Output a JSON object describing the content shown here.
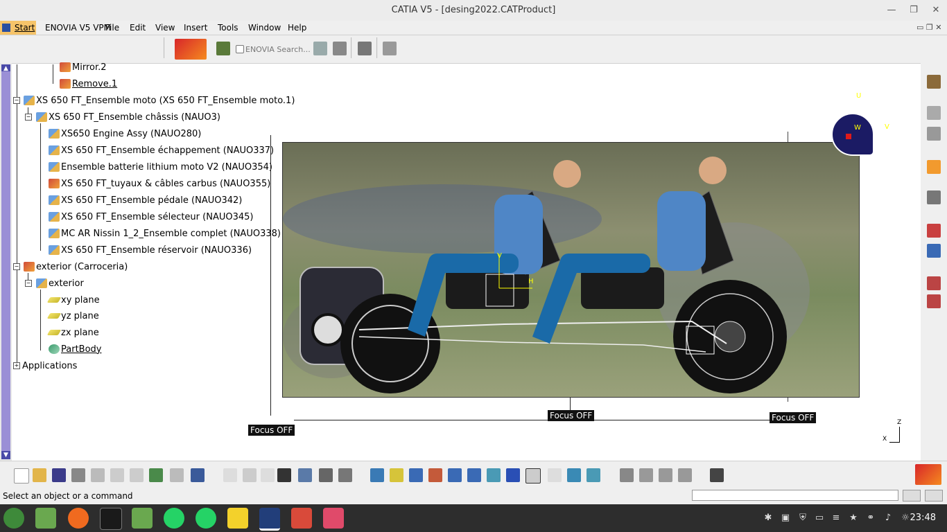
{
  "window": {
    "title": "CATIA V5 - [desing2022.CATProduct]"
  },
  "menubar": {
    "start": "Start",
    "items": [
      "ENOVIA V5 VPM",
      "File",
      "Edit",
      "View",
      "Insert",
      "Tools",
      "Window",
      "Help"
    ]
  },
  "toolbar": {
    "enovia_search": "ENOVIA Search..."
  },
  "tree": {
    "mirror": "Mirror.2",
    "remove": "Remove.1",
    "root": "XS 650 FT_Ensemble moto (XS 650 FT_Ensemble moto.1)",
    "chassis": "XS 650 FT_Ensemble châssis (NAUO3)",
    "children": [
      "XS650 Engine Assy (NAUO280)",
      "XS 650 FT_Ensemble échappement (NAUO337)",
      "Ensemble batterie lithium moto V2 (NAUO354)",
      "XS 650 FT_tuyaux & câbles carbus (NAUO355)",
      "XS 650 FT_Ensemble pédale (NAUO342)",
      "XS 650 FT_Ensemble sélecteur (NAUO345)",
      "MC AR Nissin 1_2_Ensemble complet (NAUO338)",
      "XS 650 FT_Ensemble réservoir (NAUO336)"
    ],
    "exterior_root": "exterior (Carroceria)",
    "exterior": "exterior",
    "xy_plane": "xy plane",
    "yz_plane": "yz plane",
    "zx_plane": "zx plane",
    "partbody": "PartBody",
    "applications": "Applications"
  },
  "viewport": {
    "focus_left": "Focus OFF",
    "focus_center": "Focus OFF",
    "focus_right": "Focus OFF",
    "axis_v": "V",
    "axis_h": "H",
    "compass_u": "U",
    "compass_v": "V",
    "compass_w": "W",
    "axis_z": "Z",
    "axis_x": "X"
  },
  "status": {
    "message": "Select an object or a command"
  },
  "taskbar": {
    "clock": "23:48"
  }
}
